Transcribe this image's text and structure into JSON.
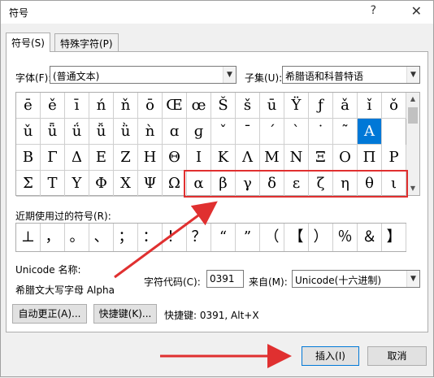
{
  "dialog": {
    "title": "符号",
    "help_glyph": "?",
    "close_glyph": "✕"
  },
  "tabs": [
    {
      "label": "符号(S)"
    },
    {
      "label": "特殊字符(P)"
    }
  ],
  "font": {
    "label": "字体(F):",
    "value": "(普通文本)"
  },
  "subset": {
    "label": "子集(U):",
    "value": "希腊语和科普特语"
  },
  "symbol_rows": [
    [
      "ē",
      "ě",
      "ī",
      "ń",
      "ň",
      "ō",
      "Œ",
      "œ",
      "Š",
      "š",
      "ū",
      "Ÿ",
      "ƒ",
      "ǎ",
      "ǐ",
      "ǒ"
    ],
    [
      "ǔ",
      "ǖ",
      "ǘ",
      "ǚ",
      "ǜ",
      "ǹ",
      "ɑ",
      "ɡ",
      "ˇ",
      "ˉ",
      "ˊ",
      "ˋ",
      "˙",
      "˜",
      "Α"
    ],
    [
      "Β",
      "Γ",
      "Δ",
      "Ε",
      "Ζ",
      "Η",
      "Θ",
      "Ι",
      "Κ",
      "Λ",
      "Μ",
      "Ν",
      "Ξ",
      "Ο",
      "Π",
      "Ρ"
    ],
    [
      "Σ",
      "Τ",
      "Υ",
      "Φ",
      "Χ",
      "Ψ",
      "Ω",
      "α",
      "β",
      "γ",
      "δ",
      "ε",
      "ζ",
      "η",
      "θ",
      "ι"
    ]
  ],
  "recent": {
    "label": "近期使用过的符号(R):",
    "symbols": [
      "⊥",
      "，",
      "。",
      "、",
      "；",
      "：",
      "！",
      "？",
      "“",
      "”",
      "（",
      "【",
      "）",
      "％",
      "＆",
      "】"
    ]
  },
  "unicode": {
    "name_label": "Unicode 名称:",
    "name_value": "希腊文大写字母 Alpha"
  },
  "char_code": {
    "label": "字符代码(C):",
    "value": "0391"
  },
  "from": {
    "label": "来自(M):",
    "value": "Unicode(十六进制)"
  },
  "buttons": {
    "autocorrect": "自动更正(A)...",
    "shortcut_key": "快捷键(K)...",
    "insert": "插入(I)",
    "cancel": "取消"
  },
  "shortcut_text": "快捷键: 0391, Alt+X",
  "colors": {
    "selection": "#0078d7",
    "annotation": "#e03030"
  }
}
